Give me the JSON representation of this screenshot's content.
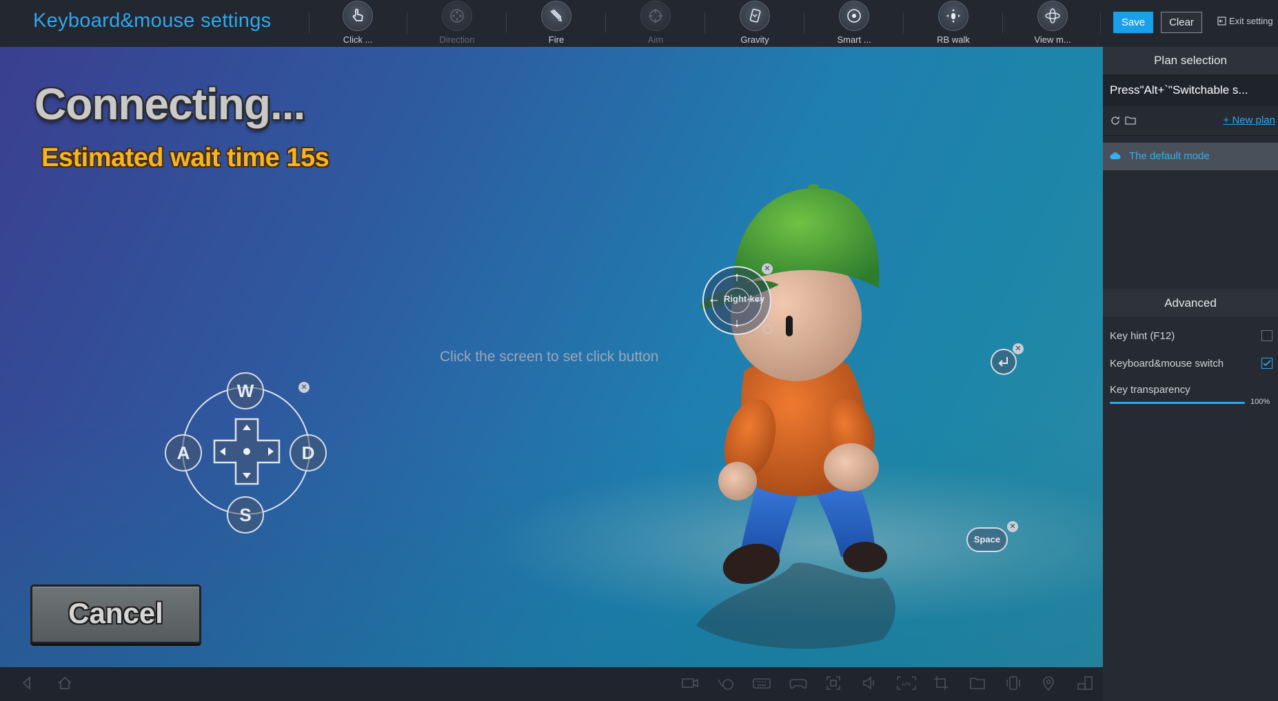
{
  "header": {
    "title": "Keyboard&mouse settings",
    "tools": [
      {
        "label": "Click ...",
        "icon": "click-hand-icon",
        "enabled": true
      },
      {
        "label": "Direction",
        "icon": "direction-pad-icon",
        "enabled": false
      },
      {
        "label": "Fire",
        "icon": "fire-bullet-icon",
        "enabled": true
      },
      {
        "label": "Aim",
        "icon": "aim-crosshair-icon",
        "enabled": false
      },
      {
        "label": "Gravity",
        "icon": "gravity-phone-icon",
        "enabled": true
      },
      {
        "label": "Smart ...",
        "icon": "smart-cast-icon",
        "enabled": true
      },
      {
        "label": "RB walk",
        "icon": "rb-walk-icon",
        "enabled": true
      },
      {
        "label": "View m...",
        "icon": "view-move-icon",
        "enabled": true
      }
    ],
    "save_label": "Save",
    "clear_label": "Clear",
    "exit_label": "Exit setting"
  },
  "game": {
    "connecting_text": "Connecting...",
    "wait_text": "Estimated wait time 15s",
    "hint_text": "Click the screen to set click button",
    "cancel_label": "Cancel",
    "wasd": {
      "up": "W",
      "left": "A",
      "right": "D",
      "down": "S"
    },
    "right_key_label": "Right-key",
    "space_label": "Space"
  },
  "panel": {
    "plan_title": "Plan selection",
    "plan_switch_text": "Press\"Alt+`\"Switchable s...",
    "new_plan_label": "+ New plan",
    "default_mode_label": "The default mode",
    "advanced_title": "Advanced",
    "key_hint_label": "Key hint (F12)",
    "key_hint_checked": false,
    "km_switch_label": "Keyboard&mouse switch",
    "km_switch_checked": true,
    "transparency_label": "Key transparency",
    "transparency_value": "100%"
  },
  "colors": {
    "accent": "#2fa8ef",
    "save_bg": "#1aa0ea",
    "wait_text": "#f2b52a"
  }
}
